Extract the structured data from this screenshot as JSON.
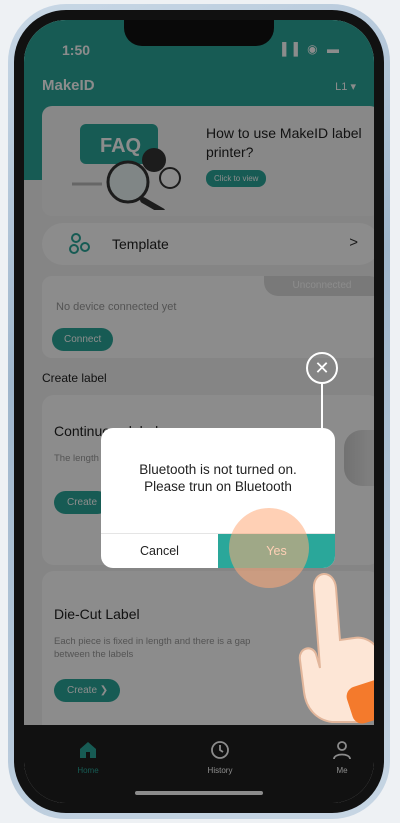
{
  "status_bar": {
    "time": "1:50",
    "icons": "▐▐ ◉ ▬"
  },
  "header": {
    "app_title": "MakeID",
    "user_tag": "L1 ▾"
  },
  "banner": {
    "title": "How to use MakeID label printer?",
    "button_label": "Click to view",
    "art_text": "FAQ"
  },
  "template": {
    "label": "Template",
    "chevron": ">"
  },
  "device": {
    "status_tab": "Unconnected",
    "message": "No device connected yet",
    "connect_label": "Connect"
  },
  "section": {
    "title": "Create label"
  },
  "cards": [
    {
      "title": "Continuous label",
      "desc": "The length of ...",
      "create_label": "Create"
    },
    {
      "title": "Die-Cut Label",
      "desc": "Each piece is fixed in length and there is a gap between the labels",
      "create_label": "Create ❯"
    }
  ],
  "tabbar": {
    "home": "Home",
    "history": "History",
    "me": "Me"
  },
  "dialog": {
    "message_line1": "Bluetooth is not turned on.",
    "message_line2": "Please trun on Bluetooth",
    "cancel_label": "Cancel",
    "yes_label": "Yes"
  },
  "overlay_close": "✕",
  "colors": {
    "accent": "#2aa79a",
    "tabbar": "#1f1f1f",
    "overlay": "rgba(0,0,0,0.45)"
  }
}
